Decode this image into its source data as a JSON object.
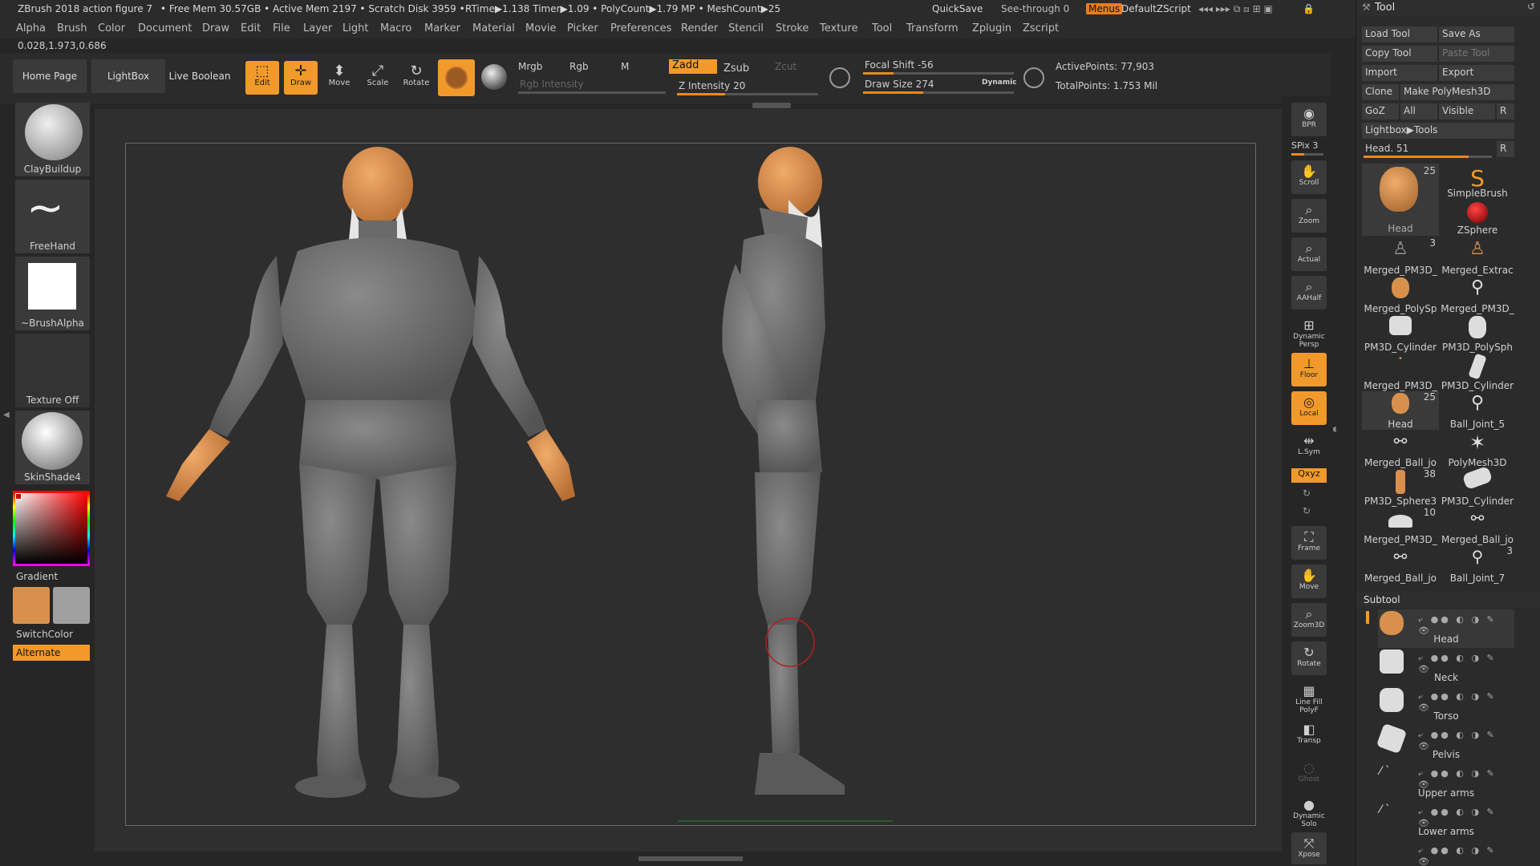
{
  "titlebar": {
    "doc": "ZBrush 2018 action figure 7",
    "stats": "• Free Mem 30.57GB • Active Mem 2197 • Scratch Disk 3959 •",
    "rtime": "RTime▶1.138 Timer▶1.09 • PolyCount▶1.79 MP • MeshCount▶25",
    "quicksave": "QuickSave",
    "seethrough": "See-through 0",
    "menus": "Menus",
    "script": "DefaultZScript"
  },
  "menubar": [
    "Alpha",
    "Brush",
    "Color",
    "Document",
    "Draw",
    "Edit",
    "File",
    "Layer",
    "Light",
    "Macro",
    "Marker",
    "Material",
    "Movie",
    "Picker",
    "Preferences",
    "Render",
    "Stencil",
    "Stroke",
    "Texture",
    "Tool",
    "Transform",
    "Zplugin",
    "Zscript"
  ],
  "coords": "0.028,1.973,0.686",
  "shelf": {
    "home": "Home Page",
    "lightbox": "LightBox",
    "liveboolean": "Live Boolean",
    "edit": "Edit",
    "draw": "Draw",
    "move": "Move",
    "scale": "Scale",
    "rotate": "Rotate",
    "mrgb": "Mrgb",
    "rgb": "Rgb",
    "m": "M",
    "zadd": "Zadd",
    "zsub": "Zsub",
    "zcut": "Zcut",
    "rgb_intensity": "Rgb Intensity",
    "z_intensity": "Z Intensity 20",
    "z_intensity_value": 20,
    "focal_shift": "Focal Shift -56",
    "focal_shift_value": -56,
    "draw_size": "Draw Size 274",
    "draw_size_value": 274,
    "dynamic": "Dynamic",
    "active_points": "ActivePoints: 77,903",
    "total_points": "TotalPoints: 1.753 Mil"
  },
  "left_tray": {
    "brush": "ClayBuildup",
    "stroke": "FreeHand",
    "alpha": "~BrushAlpha",
    "texture": "Texture Off",
    "material": "SkinShade4",
    "gradient": "Gradient",
    "switchcolor": "SwitchColor",
    "alternate": "Alternate"
  },
  "right_dock": [
    "BPR",
    "SPix 3",
    "Scroll",
    "Zoom",
    "Actual",
    "AAHalf",
    "Dynamic Persp",
    "Floor",
    "Local",
    "L.Sym",
    "Qxyz",
    "Frame",
    "Move",
    "Zoom3D",
    "Rotate",
    "Line Fill PolyF",
    "Transp",
    "Ghost",
    "Dynamic Solo",
    "Xpose"
  ],
  "tool_panel": {
    "title": "Tool",
    "load": "Load Tool",
    "saveas": "Save As",
    "copy": "Copy Tool",
    "paste": "Paste Tool",
    "import": "Import",
    "export": "Export",
    "clone": "Clone",
    "make": "Make PolyMesh3D",
    "goz": "GoZ",
    "all": "All",
    "visible": "Visible",
    "r": "R",
    "lightbox_tools": "Lightbox▶Tools",
    "head_slider": "Head. 51",
    "head_slider_value": 51,
    "items": [
      {
        "name": "Head",
        "count": "25"
      },
      {
        "name": "SimpleBrush",
        "count": ""
      },
      {
        "name": "ZSphere",
        "count": ""
      },
      {
        "name": "Merged_PM3D_",
        "count": "3"
      },
      {
        "name": "Merged_Extrac",
        "count": ""
      },
      {
        "name": "Merged_PolySp",
        "count": ""
      },
      {
        "name": "Merged_PM3D_",
        "count": ""
      },
      {
        "name": "PM3D_Cylinder",
        "count": ""
      },
      {
        "name": "PM3D_PolySph",
        "count": ""
      },
      {
        "name": "Merged_PM3D_",
        "count": ""
      },
      {
        "name": "PM3D_Cylinder",
        "count": ""
      },
      {
        "name": "Head",
        "count": "25"
      },
      {
        "name": "Ball_Joint_5",
        "count": ""
      },
      {
        "name": "Merged_Ball_jo",
        "count": ""
      },
      {
        "name": "PolyMesh3D",
        "count": ""
      },
      {
        "name": "PM3D_Sphere3",
        "count": "38"
      },
      {
        "name": "PM3D_Cylinder",
        "count": ""
      },
      {
        "name": "Merged_PM3D_",
        "count": "10"
      },
      {
        "name": "Merged_Ball_jo",
        "count": ""
      },
      {
        "name": "Merged_Ball_jo",
        "count": ""
      },
      {
        "name": "Ball_Joint_7",
        "count": "3"
      }
    ],
    "subtool_title": "Subtool",
    "subtools": [
      "Head",
      "Neck",
      "Torso",
      "Pelvis",
      "Upper arms",
      "Lower arms"
    ]
  },
  "colors": {
    "accent": "#f19a2b",
    "skin": "#d9904d",
    "body": "#6f6f6f",
    "main_color": "#d9904d",
    "secondary_color": "#a0a0a0"
  }
}
